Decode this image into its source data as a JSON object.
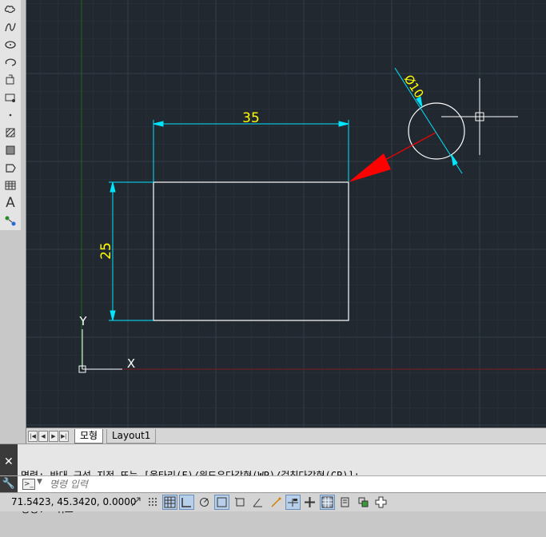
{
  "toolbar": {
    "icons": [
      "revision-cloud-icon",
      "spline-icon",
      "ellipse-icon",
      "ellipse-arc-icon",
      "insert-block-icon",
      "make-block-icon",
      "point-icon",
      "hatch-icon",
      "gradient-icon",
      "region-icon",
      "table-icon",
      "multiline-text-icon",
      "add-selected-icon"
    ],
    "text_glyph": "A"
  },
  "drawing": {
    "dim_horizontal": "35",
    "dim_vertical": "25",
    "dim_diameter": "Ø10",
    "ucs_x": "X",
    "ucs_y": "Y"
  },
  "colors": {
    "background": "#212830",
    "dimension": "#00e5ff",
    "dim_text": "#ffff00",
    "geometry": "#ffffff",
    "leader": "#ff0000",
    "x_axis": "#7a1c1c",
    "y_axis": "#1c6a1c"
  },
  "tabs": {
    "model": "모형",
    "layout1": "Layout1"
  },
  "command": {
    "line1": "명령: 반대 구석 지정 또는 [울타리(F)/윈도우다각형(WP)/걸침다각형(CP)]:",
    "line2": "명령: *취소*",
    "placeholder": "명령 입력"
  },
  "status": {
    "coordinates": "71.5423, 45.3420, 0.0000"
  }
}
